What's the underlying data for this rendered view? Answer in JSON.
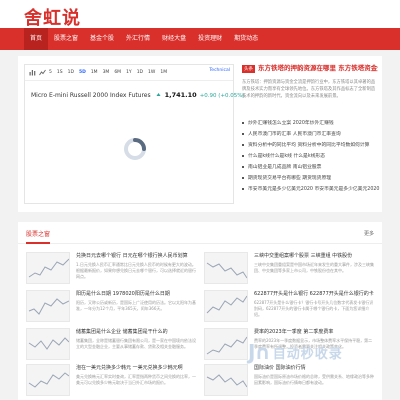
{
  "site": {
    "logo": "舍虹说"
  },
  "nav": {
    "items": [
      {
        "label": "首页",
        "active": true
      },
      {
        "label": "股票之窗",
        "active": false
      },
      {
        "label": "基金个股",
        "active": false
      },
      {
        "label": "外汇行情",
        "active": false
      },
      {
        "label": "财经大盘",
        "active": false
      },
      {
        "label": "投资理财",
        "active": false
      },
      {
        "label": "期货动态",
        "active": false
      }
    ]
  },
  "widget": {
    "timeframes": [
      "5",
      "1S",
      "1D",
      "5D",
      "1M",
      "3M",
      "6M",
      "1Y",
      "1D",
      "1W",
      "1M"
    ],
    "active_timeframe_index": 3,
    "label_right": "Technical",
    "symbol": "Micro E-mini Russell 2000 Index Futures",
    "price": "1,741.10",
    "change": "+0.90 (+0.05%)",
    "colors": {
      "up": "#26a69a",
      "link": "#2962ff"
    }
  },
  "featured": {
    "badge": "头条",
    "title": "东方铁塔的押韵资源在哪里 东方铁塔资金全流",
    "intro": "东方铁塔：押韵资源与资金全流是押韵行业中，东方铁塔以其卓著的品牌及技术实力而享有全球领先地位。东方铁塔及其作品标志了全新制造技术的押韵的新时代，资金流向以及未来发展前景。",
    "links": [
      "炒外汇赚钱怎么立案 2020年炒外汇赚钱",
      "人民币澳门币的汇率 人民币澳门币汇率查询",
      "资料分析中的同比平均 资料分析中的同比平均数如何计算",
      "什么是k线什么是k线 什么是k线形态",
      "南山铝业是几成品牌 南山铝业股票",
      "期货现货交易平台有哪些 期货现货原理",
      "币安币美元是多少亿美元2020 币安币美元是多少亿美元2020"
    ]
  },
  "section": {
    "title": "股票之窗",
    "more": "更多",
    "cards": [
      {
        "title": "兑换日元去哪个银行 日元在哪个银行换人民币划算",
        "desc": "1.日元兑换人民币汇率通常比日元兑换人民币的时候有更大的波动。根据最新报价，如果你想兑换日元去哪个银行，可以选择就近的银行网点。"
      },
      {
        "title": "三峡中交重组案哪个股票 三峡重组 中铁股份",
        "desc": "三峡中交集团重组案是中国市场近年来发生的重大事件，涉及三峡集团、中交集团等多家上市公司，中铁股份也在其中。"
      },
      {
        "title": "阳历是什么日期 1978020阳历是什么日期",
        "desc": "阳历，又称公历或新历，是国际上广泛使用的历法。它以太阳年为基准，一年分为12个月，平年365天，闰年366天。"
      },
      {
        "title": "622877开头是什么银行 622877开头是什么银行的卡",
        "desc": "622877开头是什么银行卡？银行卡号开头几位数字代表发卡银行识别码，622877开头的银行卡属于哪个银行的卡，下面为您详细介绍。"
      },
      {
        "title": "储蓄集团是什么企业 储蓄集团是干什么的",
        "desc": "储蓄集团，全称是储蓄银行集团有限公司，是一家在中国境内依法设立的大型金融企业，主要从事储蓄存款、贷款及相关金融服务。"
      },
      {
        "title": "费率的2023年一季度 第二季度费率",
        "desc": "费率的2023年一季度数据显示，市场整体费率水平保持平稳，第二季度费率有所调整，投资者需要关注相关政策变化。"
      },
      {
        "title": "泡在一美元兑换多少韩元 一美元兑换多少韩元啊",
        "desc": "美元兑换韩元汇率实时查询，汇率是指两种货币之间兑换的比率，一美元可以兑换多少韩元取决于当日外汇市场的报价。"
      },
      {
        "title": "国际油价 国际油价行情",
        "desc": "国际油价是国际原油市场价格的总称，受供需关系、地缘政治等多种因素影响，国际油价行情每日都有波动。"
      }
    ]
  },
  "watermark": {
    "text": "自动秒收录"
  }
}
